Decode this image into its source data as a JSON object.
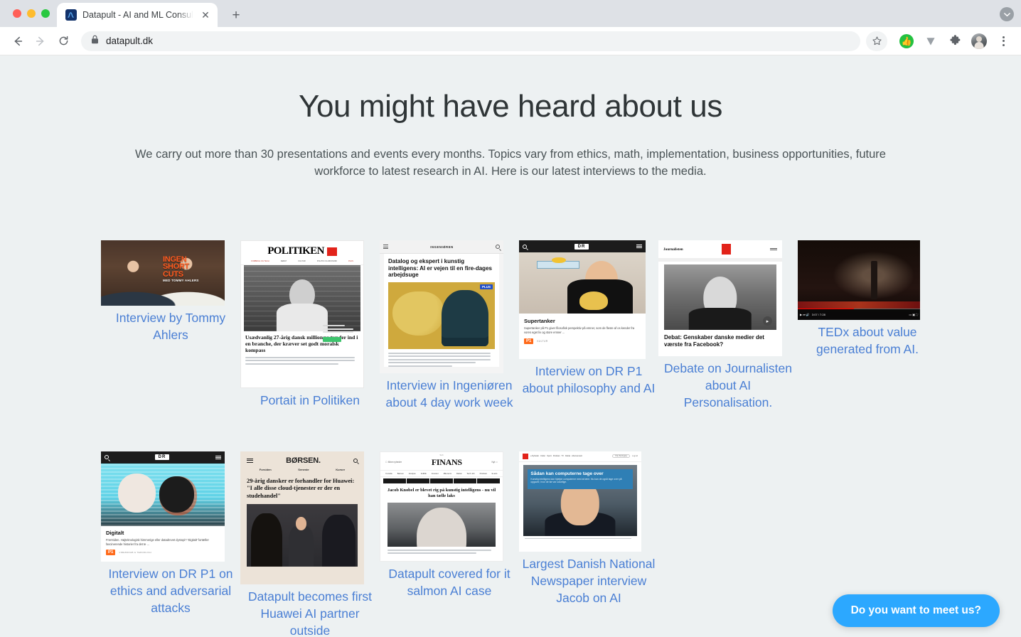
{
  "browser": {
    "tab": {
      "title": "Datapult - AI and ML Consultant",
      "favicon_name": "datapult-favicon",
      "close_label": "✕"
    },
    "new_tab_label": "+",
    "nav": {
      "back": "←",
      "forward": "→",
      "reload": "⟳"
    },
    "omnibox": {
      "url": "datapult.dk",
      "lock_icon": "lock-icon"
    },
    "toolbar_icons": [
      "bookmark-star-icon",
      "thumbs-up-extension-icon",
      "v-extension-icon",
      "extensions-puzzle-icon",
      "profile-avatar",
      "browser-menu-icon"
    ]
  },
  "page": {
    "title": "You might have heard about us",
    "subtitle": "We carry out more than 30 presentations and events every months. Topics vary from ethics, math, implementation, business opportunities, future workforce to latest research in AI. Here is our latest interviews to the media.",
    "link_color": "#4a7fd4",
    "background_color": "#edf1f2"
  },
  "cards": [
    {
      "caption": "Interview by Tommy Ahlers",
      "overlay_title": "INGEN SHORT CUTS",
      "overlay_sub": "MED TOMMY AHLERS"
    },
    {
      "caption": "Portait in Politiken",
      "brand": "POLITIKEN",
      "headline": "Usædvanlig 27-årig dansk millionær træder ind i en branche, der kræver set godt moralsk kompass"
    },
    {
      "caption": "Interview in Ingeniøren about 4 day work week",
      "brand": "INGENIØREN",
      "headline": "Datalog og ekspert i kunstig intelligens: AI er vejen til en fire-dages arbejdsuge",
      "badge": "PLUS"
    },
    {
      "caption": "Interview on DR P1 about philosophy and AI",
      "brand": "DR",
      "headline": "Supertanker",
      "blurb": "Supertanker på P1 giver filosofisk perspektiv på emner, som de fleste af os kender fra vores eget liv og store emner ...",
      "tag": "P1",
      "tag_sub": "KULTUR"
    },
    {
      "caption": "Debate on Journalisten about AI Personalisation.",
      "brand": "Journalisten",
      "headline": "Debat: Genskaber danske medier det værste fra Facebook?"
    },
    {
      "caption": "TEDx about value generated from AI.",
      "player": "youtube-player",
      "time": "3:07 / 7:28"
    },
    {
      "caption": "Interview on DR P1 on ethics and adversarial attacks",
      "brand": "DR",
      "headline": "Digitalt",
      "blurb": "Fremtiden. Højteknologisk himmerige eller datadrevet dystopi? 'Digitalt' fortæller fascinerende historier fra det te ...",
      "tag": "P1",
      "tag_sub": "VIDENSKAB & TEKNOLOGI"
    },
    {
      "caption": "Datapult becomes first Huawei AI partner outside",
      "brand": "BØRSEN.",
      "nav": [
        "Forsiden",
        "Seneste",
        "Kurser"
      ],
      "headline": "29-årig dansker er forhandler for Huawei: \"I alle disse cloud-tjenester er der en studehandel\""
    },
    {
      "caption": "Datapult covered for it salmon AI case",
      "brand": "FINANS",
      "headline": "Jacob Knobel er blevet rig på kunstig intelligens - nu vil han tælle laks"
    },
    {
      "caption": "Largest Danish National Newspaper interview Jacob on AI",
      "headline": "Sådan kan computerne tage over"
    }
  ],
  "chat": {
    "label": "Do you want to meet us?",
    "color": "#2ca8ff"
  }
}
